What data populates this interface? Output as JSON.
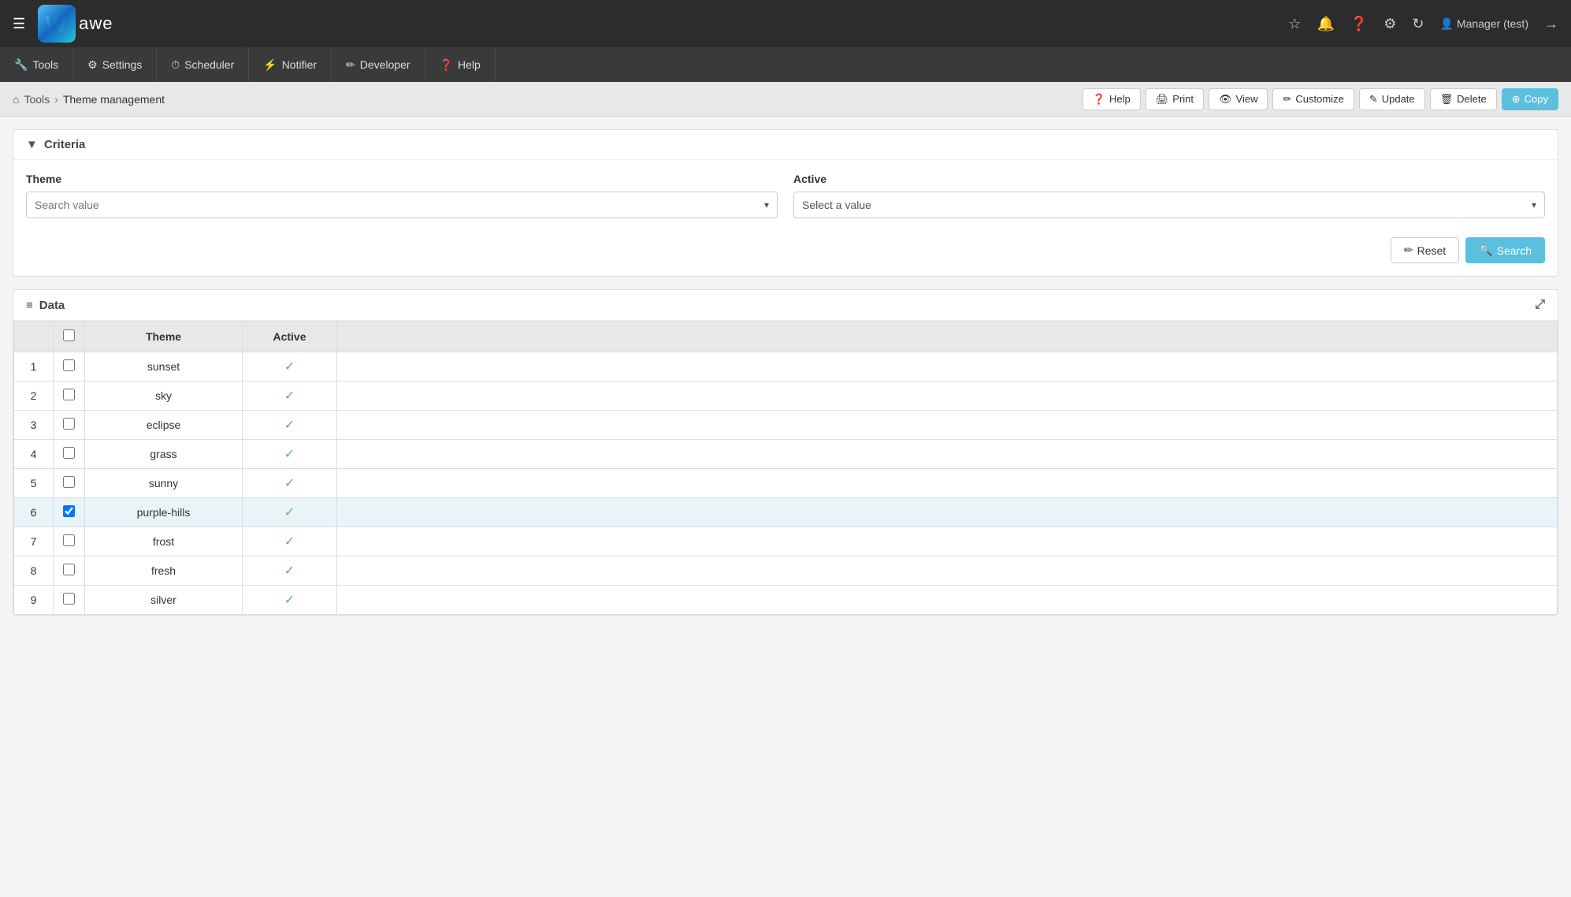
{
  "app": {
    "logo_letter": "W",
    "logo_text": "awe"
  },
  "topbar": {
    "star_icon": "★",
    "bell_icon": "🔔",
    "help_icon": "?",
    "settings_icon": "⚙",
    "refresh_icon": "↻",
    "user_label": "Manager (test)",
    "logout_icon": "→"
  },
  "menu": {
    "items": [
      {
        "icon": "🔧",
        "label": "Tools"
      },
      {
        "icon": "⚙",
        "label": "Settings"
      },
      {
        "icon": "📅",
        "label": "Scheduler"
      },
      {
        "icon": "⚡",
        "label": "Notifier"
      },
      {
        "icon": "✏",
        "label": "Developer"
      },
      {
        "icon": "?",
        "label": "Help"
      }
    ]
  },
  "breadcrumb": {
    "home_icon": "⌂",
    "tools_link": "Tools",
    "separator": "›",
    "current": "Theme management",
    "actions": [
      {
        "icon": "?",
        "label": "Help"
      },
      {
        "icon": "🖨",
        "label": "Print"
      },
      {
        "icon": "👁",
        "label": "View"
      },
      {
        "icon": "✏",
        "label": "Customize"
      },
      {
        "icon": "✎",
        "label": "Update"
      },
      {
        "icon": "🗑",
        "label": "Delete"
      },
      {
        "icon": "+",
        "label": "Copy"
      }
    ]
  },
  "criteria": {
    "section_title": "Criteria",
    "theme_label": "Theme",
    "theme_placeholder": "Search value",
    "active_label": "Active",
    "active_placeholder": "Select a value",
    "reset_label": "Reset",
    "search_label": "Search"
  },
  "data_section": {
    "title": "Data",
    "columns": [
      "Theme",
      "Active"
    ],
    "rows": [
      {
        "num": 1,
        "theme": "sunset",
        "active": true,
        "checked": false
      },
      {
        "num": 2,
        "theme": "sky",
        "active": true,
        "checked": false
      },
      {
        "num": 3,
        "theme": "eclipse",
        "active": true,
        "checked": false
      },
      {
        "num": 4,
        "theme": "grass",
        "active": true,
        "checked": false
      },
      {
        "num": 5,
        "theme": "sunny",
        "active": true,
        "checked": false
      },
      {
        "num": 6,
        "theme": "purple-hills",
        "active": true,
        "checked": true
      },
      {
        "num": 7,
        "theme": "frost",
        "active": true,
        "checked": false
      },
      {
        "num": 8,
        "theme": "fresh",
        "active": true,
        "checked": false
      },
      {
        "num": 9,
        "theme": "silver",
        "active": true,
        "checked": false
      }
    ]
  },
  "colors": {
    "accent_blue": "#5bc0de",
    "green_check": "#5cb85c",
    "selected_row_bg": "#e8f4f8"
  }
}
